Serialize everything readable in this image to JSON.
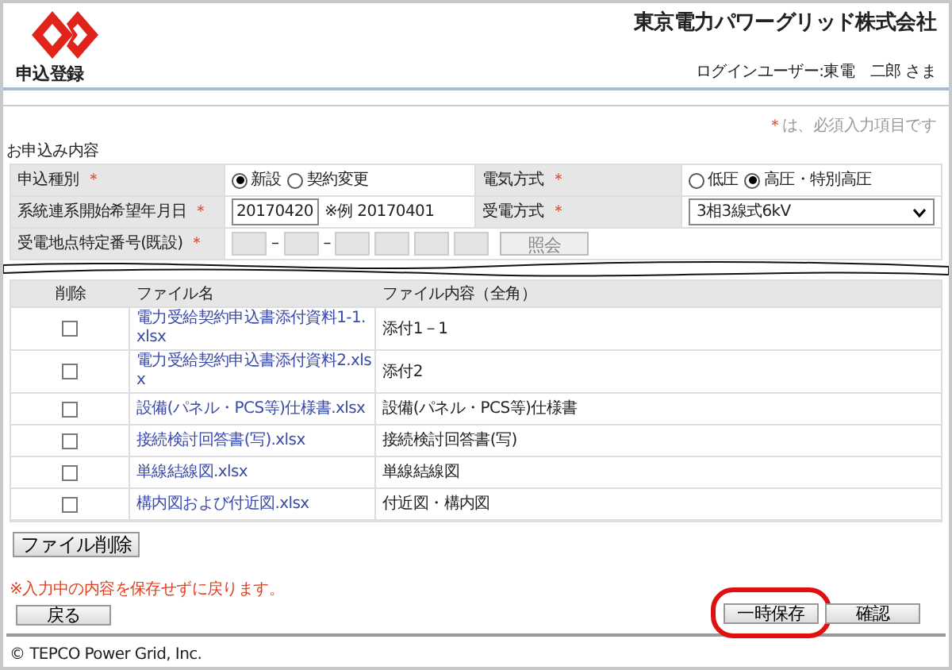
{
  "header": {
    "company": "東京電力パワーグリッド株式会社",
    "page_title": "申込登録",
    "login_user": "ログインユーザー:東電　二郎 さま"
  },
  "required_note": {
    "mark": "＊",
    "text": "は、必須入力項目です"
  },
  "section_title": "お申込み内容",
  "form_rows": [
    [
      {
        "label": "申込種別",
        "required": true,
        "kind": "radio",
        "options": [
          {
            "label": "新設",
            "selected": true
          },
          {
            "label": "契約変更",
            "selected": false
          }
        ]
      },
      {
        "label": "電気方式",
        "required": true,
        "kind": "radio",
        "options": [
          {
            "label": "低圧",
            "selected": false
          },
          {
            "label": "高圧・特別高圧",
            "selected": true
          }
        ]
      }
    ],
    [
      {
        "label": "系統連系開始希望年月日",
        "required": true,
        "kind": "date",
        "value": "20170420",
        "hint": "※例 20170401"
      },
      {
        "label": "受電方式",
        "required": true,
        "kind": "select",
        "value": "3相3線式6kV"
      }
    ],
    [
      {
        "label": "受電地点特定番号(既設)",
        "required": true,
        "kind": "number_fields",
        "separator": "–",
        "fields": [
          {
            "kind": "dash"
          },
          {
            "kind": "dash"
          },
          {
            "kind": "plain"
          },
          {
            "kind": "plain"
          },
          {
            "kind": "plain"
          },
          {
            "kind": "plain"
          }
        ],
        "button": "照会"
      }
    ]
  ],
  "files": {
    "columns": [
      "削除",
      "ファイル名",
      "ファイル内容（全角）"
    ],
    "rows": [
      {
        "checked": false,
        "name": "電力受給契約申込書添付資料1-1.xlsx",
        "content": "添付1－1"
      },
      {
        "checked": false,
        "name": "電力受給契約申込書添付資料2.xlsx",
        "content": "添付2"
      },
      {
        "checked": false,
        "name": "設備(パネル・PCS等)仕様書.xlsx",
        "content": "設備(パネル・PCS等)仕様書"
      },
      {
        "checked": false,
        "name": "接続検討回答書(写).xlsx",
        "content": "接続検討回答書(写)"
      },
      {
        "checked": false,
        "name": "単線結線図.xlsx",
        "content": "単線結線図"
      },
      {
        "checked": false,
        "name": "構内図および付近図.xlsx",
        "content": "付近図・構内図"
      }
    ]
  },
  "delete_button": "ファイル削除",
  "back_note": "※入力中の内容を保存せずに戻ります。",
  "back_button": "戻る",
  "actions": [
    {
      "label": "一時保存",
      "highlighted": true
    },
    {
      "label": "確認",
      "highlighted": false
    }
  ],
  "footer": "© TEPCO Power Grid, Inc."
}
